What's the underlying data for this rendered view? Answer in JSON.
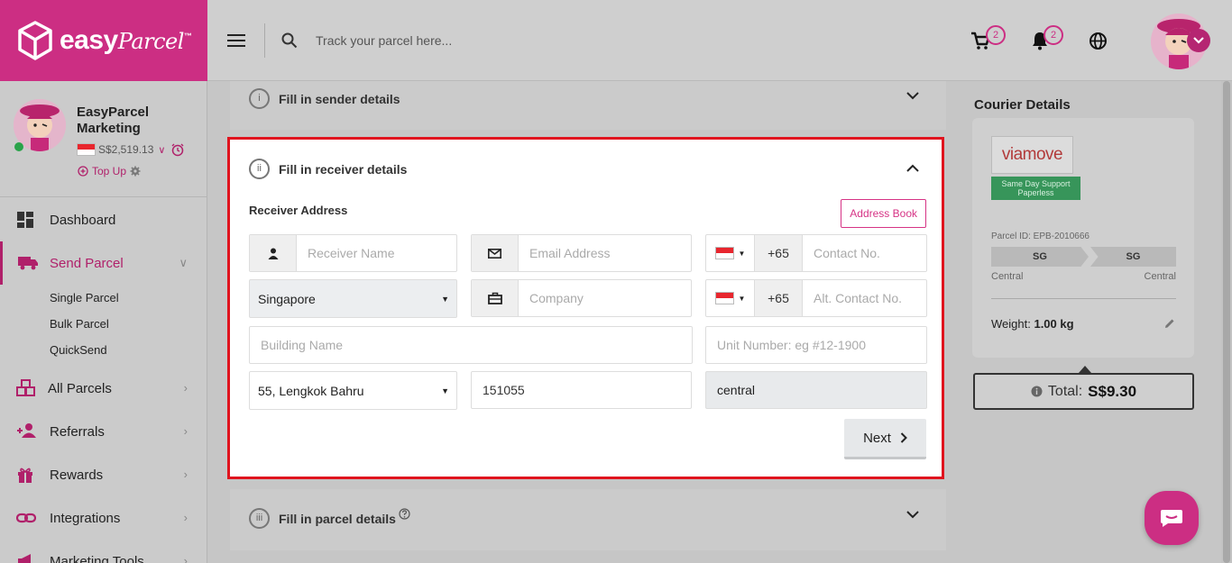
{
  "brand": {
    "name_bold": "easy",
    "name_script": "Parcel",
    "tm": "™"
  },
  "search": {
    "placeholder": "Track your parcel here..."
  },
  "header": {
    "cart_count": "2",
    "notification_count": "2"
  },
  "profile": {
    "name": "EasyParcel Marketing",
    "balance": "S$2,519.13",
    "topup_label": "Top Up"
  },
  "nav": {
    "dashboard": "Dashboard",
    "send_parcel": "Send Parcel",
    "single_parcel": "Single Parcel",
    "bulk_parcel": "Bulk Parcel",
    "quicksend": "QuickSend",
    "all_parcels": "All Parcels",
    "referrals": "Referrals",
    "rewards": "Rewards",
    "integrations": "Integrations",
    "marketing_tools": "Marketing Tools"
  },
  "sections": {
    "sender": {
      "num": "i",
      "title": "Fill in sender details"
    },
    "receiver": {
      "num": "ii",
      "title": "Fill in receiver details"
    },
    "parcel": {
      "num": "iii",
      "title": "Fill in parcel details"
    }
  },
  "receiver_form": {
    "heading": "Receiver Address",
    "address_book": "Address Book",
    "name_placeholder": "Receiver Name",
    "email_placeholder": "Email Address",
    "country_code": "+65",
    "contact_placeholder": "Contact No.",
    "country": "Singapore",
    "company_placeholder": "Company",
    "alt_contact_placeholder": "Alt. Contact No.",
    "building_placeholder": "Building Name",
    "unit_placeholder": "Unit Number: eg #12-1900",
    "street": "55, Lengkok Bahru",
    "postcode": "151055",
    "area": "central",
    "next_label": "Next"
  },
  "courier": {
    "title": "Courier Details",
    "logo_text": "viamove",
    "service_tag": "Same Day Support Paperless",
    "parcel_id": "Parcel ID: EPB-2010666",
    "from_code": "SG",
    "to_code": "SG",
    "from_area": "Central",
    "to_area": "Central",
    "weight_label": "Weight:",
    "weight_value": "1.00 kg",
    "total_label": "Total:",
    "total_value": "S$9.30"
  },
  "colors": {
    "brand_pink": "#cc2e83",
    "highlight_red": "#e0141e",
    "accent_green": "#37955a"
  }
}
